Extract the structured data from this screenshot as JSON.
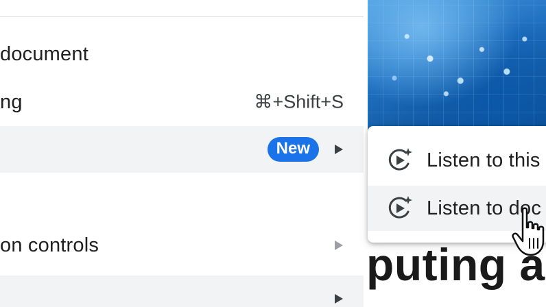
{
  "menu": {
    "items": [
      {
        "label": "document"
      },
      {
        "label": "ng",
        "shortcut": "⌘+Shift+S"
      },
      {
        "label": "",
        "badge": "New"
      },
      {
        "label": ""
      },
      {
        "label": "on controls"
      },
      {
        "label": ""
      }
    ]
  },
  "submenu": {
    "items": [
      {
        "label": "Listen to this"
      },
      {
        "label": "Listen to doc"
      }
    ]
  },
  "document": {
    "heading": "puting a"
  },
  "colors": {
    "accent": "#1a73e8",
    "hover": "#f1f3f4"
  }
}
